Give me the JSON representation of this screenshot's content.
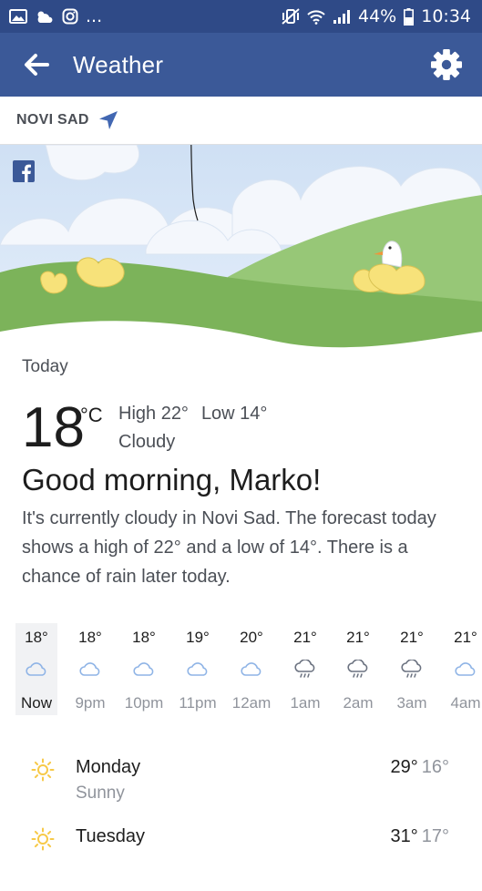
{
  "status_bar": {
    "left_icons": [
      "gallery-icon",
      "cloud-sun-icon",
      "instagram-icon",
      "more-dots-icon"
    ],
    "overflow": "...",
    "battery": "44%",
    "time": "10:34"
  },
  "app_bar": {
    "title": "Weather",
    "back_icon": "arrow-left-icon",
    "settings_icon": "gear-icon"
  },
  "location": {
    "name": "NOVI SAD",
    "icon": "location-arrow-icon"
  },
  "hero": {
    "brand_icon": "facebook-icon"
  },
  "today": {
    "label": "Today",
    "temperature": "18",
    "unit": "°C",
    "high": "High 22°",
    "low": "Low 14°",
    "condition": "Cloudy",
    "greeting": "Good morning, Marko!",
    "summary": "It's currently cloudy in Novi Sad. The forecast today shows a high of 22° and a low of 14°. There is a chance of rain later today."
  },
  "hourly": [
    {
      "temp": "18°",
      "time": "Now",
      "icon": "cloud-icon",
      "active": true
    },
    {
      "temp": "18°",
      "time": "9pm",
      "icon": "cloud-icon"
    },
    {
      "temp": "18°",
      "time": "10pm",
      "icon": "cloud-icon"
    },
    {
      "temp": "19°",
      "time": "11pm",
      "icon": "cloud-icon"
    },
    {
      "temp": "20°",
      "time": "12am",
      "icon": "cloud-icon"
    },
    {
      "temp": "21°",
      "time": "1am",
      "icon": "rain-cloud-icon"
    },
    {
      "temp": "21°",
      "time": "2am",
      "icon": "rain-cloud-icon"
    },
    {
      "temp": "21°",
      "time": "3am",
      "icon": "rain-cloud-icon"
    },
    {
      "temp": "21°",
      "time": "4am",
      "icon": "cloud-icon"
    }
  ],
  "daily": [
    {
      "day": "Monday",
      "condition": "Sunny",
      "high": "29°",
      "low": "16°",
      "icon": "sun-icon"
    },
    {
      "day": "Tuesday",
      "condition": "",
      "high": "31°",
      "low": "17°",
      "icon": "sun-icon"
    }
  ],
  "colors": {
    "status_bar": "#2f4a87",
    "app_bar": "#3b5998",
    "sun": "#f7c948",
    "cloud_outline": "#8fb4e6",
    "hill_green": "#7cb35a",
    "sky": "#d9e7f7"
  }
}
